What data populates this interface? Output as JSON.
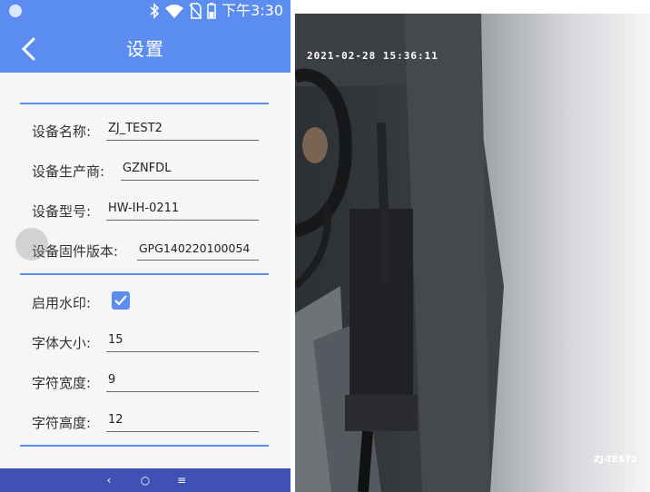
{
  "status_bar": {
    "time": "下午3:30"
  },
  "app_bar": {
    "title": "设置"
  },
  "device_info": [
    {
      "label": "设备名称:",
      "value": "ZJ_TEST2"
    },
    {
      "label": "设备生产商:",
      "value": "GZNFDL"
    },
    {
      "label": "设备型号:",
      "value": "HW-IH-0211"
    },
    {
      "label": "设备固件版本:",
      "value": "GPG140220100054"
    }
  ],
  "watermark_settings": {
    "enable_label": "启用水印:",
    "enabled": true,
    "font_size_label": "字体大小:",
    "font_size": "15",
    "char_width_label": "字符宽度:",
    "char_width": "9",
    "char_height_label": "字符高度:",
    "char_height": "12"
  },
  "nav_bar": {
    "back": "‹",
    "home": "○",
    "menu": "≡"
  },
  "camera": {
    "timestamp": "2021-02-28  15:36:11",
    "watermark": "ZJ-TEST2"
  },
  "colors": {
    "accent": "#5b8df1",
    "nav": "#3f51b5"
  }
}
